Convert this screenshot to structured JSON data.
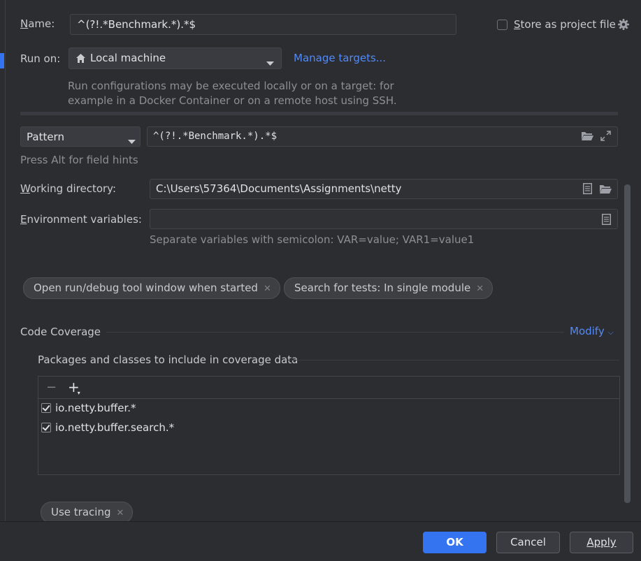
{
  "name_field": {
    "label": "Name:",
    "value": "^(?!.*Benchmark.*).*$"
  },
  "store_project": {
    "label": "Store as project file",
    "checked": false
  },
  "run_on": {
    "label": "Run on:",
    "value": "Local machine",
    "manage_link": "Manage targets...",
    "hint_line1": "Run configurations may be executed locally or on a target: for",
    "hint_line2": "example in a Docker Container or on a remote host using SSH."
  },
  "pattern": {
    "kind": "Pattern",
    "value": "^(?!.*Benchmark.*).*$"
  },
  "field_hint": "Press Alt for field hints",
  "working_directory": {
    "label": "Working directory:",
    "value": "C:\\Users\\57364\\Documents\\Assignments\\netty"
  },
  "environment": {
    "label": "Environment variables:",
    "value": "",
    "hint": "Separate variables with semicolon: VAR=value; VAR1=value1"
  },
  "chips": [
    {
      "label": "Open run/debug tool window when started"
    },
    {
      "label": "Search for tests: In single module"
    }
  ],
  "code_coverage": {
    "title": "Code Coverage",
    "modify": "Modify",
    "packages_title": "Packages and classes to include in coverage data",
    "items": [
      {
        "label": "io.netty.buffer.*",
        "checked": true
      },
      {
        "label": "io.netty.buffer.search.*",
        "checked": true
      }
    ],
    "tracing_chip": "Use tracing"
  },
  "buttons": {
    "ok": "OK",
    "cancel": "Cancel",
    "apply": "Apply"
  },
  "colors": {
    "background": "#2b2d30",
    "accent": "#3574f0",
    "link": "#548af7"
  }
}
